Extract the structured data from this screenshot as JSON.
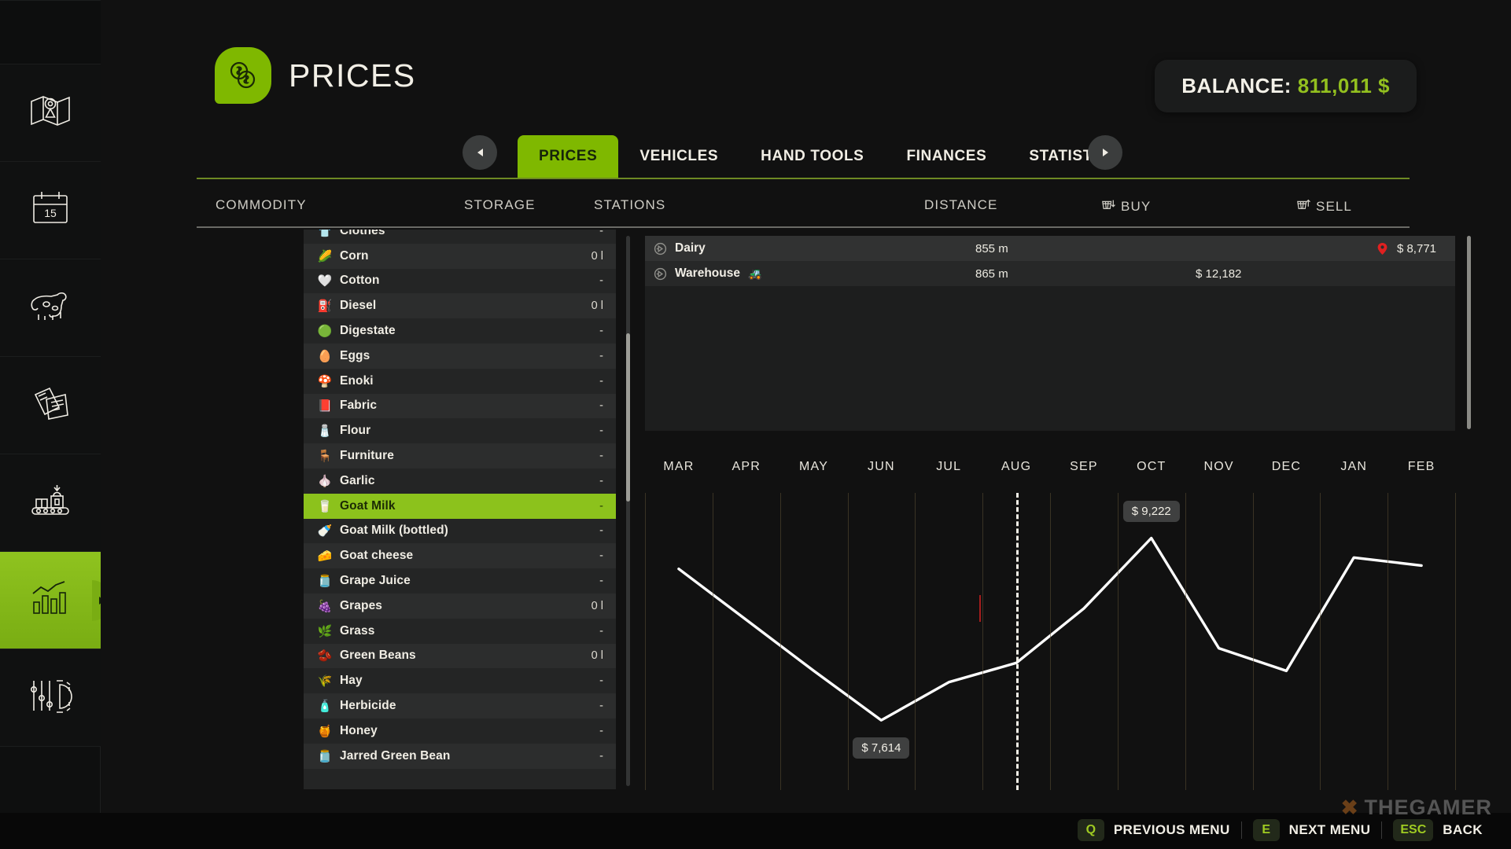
{
  "sidebar": {
    "items": [
      {
        "name": "map",
        "icon": "map-pin-icon",
        "active": false
      },
      {
        "name": "calendar",
        "icon": "calendar-15-icon",
        "active": false
      },
      {
        "name": "animals",
        "icon": "cow-icon",
        "active": false
      },
      {
        "name": "contracts",
        "icon": "documents-icon",
        "active": false
      },
      {
        "name": "production",
        "icon": "conveyor-icon",
        "active": false
      },
      {
        "name": "statistics",
        "icon": "bar-chart-icon",
        "active": true
      },
      {
        "name": "settings",
        "icon": "sliders-gear-icon",
        "active": false
      }
    ]
  },
  "header": {
    "title": "PRICES",
    "icon": "coins-dollar-icon",
    "balance_label": "BALANCE:",
    "balance_value": "811,011 $",
    "accent_color": "#7fb800",
    "balance_color": "#93c01f"
  },
  "tabs": {
    "prev_arrow": "chevron-left-icon",
    "next_arrow": "chevron-right-icon",
    "items": [
      {
        "label": "PRICES",
        "active": true
      },
      {
        "label": "VEHICLES",
        "active": false
      },
      {
        "label": "HAND TOOLS",
        "active": false
      },
      {
        "label": "FINANCES",
        "active": false
      },
      {
        "label": "STATISTICS",
        "active": false
      }
    ]
  },
  "columns": {
    "commodity": "COMMODITY",
    "storage": "STORAGE",
    "stations": "STATIONS",
    "distance": "DISTANCE",
    "buy": "BUY",
    "sell": "SELL",
    "buy_icon": "basket-down-icon",
    "sell_icon": "basket-up-icon"
  },
  "commodities": [
    {
      "name": "Clothes",
      "storage": "-",
      "emoji": "👕",
      "selected": false,
      "partial": true
    },
    {
      "name": "Corn",
      "storage": "0 l",
      "emoji": "🌽",
      "selected": false
    },
    {
      "name": "Cotton",
      "storage": "-",
      "emoji": "🤍",
      "selected": false
    },
    {
      "name": "Diesel",
      "storage": "0 l",
      "emoji": "⛽",
      "selected": false
    },
    {
      "name": "Digestate",
      "storage": "-",
      "emoji": "🟢",
      "selected": false
    },
    {
      "name": "Eggs",
      "storage": "-",
      "emoji": "🥚",
      "selected": false
    },
    {
      "name": "Enoki",
      "storage": "-",
      "emoji": "🍄",
      "selected": false
    },
    {
      "name": "Fabric",
      "storage": "-",
      "emoji": "📕",
      "selected": false
    },
    {
      "name": "Flour",
      "storage": "-",
      "emoji": "🧂",
      "selected": false
    },
    {
      "name": "Furniture",
      "storage": "-",
      "emoji": "🪑",
      "selected": false
    },
    {
      "name": "Garlic",
      "storage": "-",
      "emoji": "🧄",
      "selected": false
    },
    {
      "name": "Goat Milk",
      "storage": "-",
      "emoji": "🥛",
      "selected": true
    },
    {
      "name": "Goat Milk (bottled)",
      "storage": "-",
      "emoji": "🍼",
      "selected": false
    },
    {
      "name": "Goat cheese",
      "storage": "-",
      "emoji": "🧀",
      "selected": false
    },
    {
      "name": "Grape Juice",
      "storage": "-",
      "emoji": "🫙",
      "selected": false
    },
    {
      "name": "Grapes",
      "storage": "0 l",
      "emoji": "🍇",
      "selected": false
    },
    {
      "name": "Grass",
      "storage": "-",
      "emoji": "🌿",
      "selected": false
    },
    {
      "name": "Green Beans",
      "storage": "0 l",
      "emoji": "🫘",
      "selected": false
    },
    {
      "name": "Hay",
      "storage": "-",
      "emoji": "🌾",
      "selected": false
    },
    {
      "name": "Herbicide",
      "storage": "-",
      "emoji": "🧴",
      "selected": false
    },
    {
      "name": "Honey",
      "storage": "-",
      "emoji": "🍯",
      "selected": false
    },
    {
      "name": "Jarred Green Bean",
      "storage": "-",
      "emoji": "🫙",
      "selected": false
    }
  ],
  "stations": [
    {
      "name": "Dairy",
      "distance": "855 m",
      "buy": "",
      "sell": "$ 8,771",
      "marked": true,
      "has_vehicle_icon": false
    },
    {
      "name": "Warehouse",
      "distance": "865 m",
      "buy": "$ 12,182",
      "sell": "",
      "marked": false,
      "has_vehicle_icon": true
    }
  ],
  "chart_data": {
    "type": "line",
    "title": "",
    "xlabel": "",
    "ylabel": "",
    "categories": [
      "MAR",
      "APR",
      "MAY",
      "JUN",
      "JUL",
      "AUG",
      "SEP",
      "OCT",
      "NOV",
      "DEC",
      "JAN",
      "FEB"
    ],
    "series": [
      {
        "name": "Goat Milk price",
        "values": [
          8950,
          8500,
          8050,
          7614,
          7950,
          8120,
          8600,
          9222,
          8250,
          8050,
          9050,
          8980
        ]
      }
    ],
    "ylim": [
      7400,
      9400
    ],
    "grid": true,
    "legend": "none",
    "annotations": [
      {
        "label": "$ 7,614",
        "at_category": "JUN",
        "kind": "min-label"
      },
      {
        "label": "$ 9,222",
        "at_category": "OCT",
        "kind": "max-label"
      }
    ],
    "current_month_marker": {
      "at_category": "AUG",
      "style": "dashed-vertical-white"
    }
  },
  "footer": {
    "keys": [
      {
        "key": "Q",
        "label": "PREVIOUS MENU"
      },
      {
        "key": "E",
        "label": "NEXT MENU"
      },
      {
        "key": "ESC",
        "label": "BACK"
      }
    ],
    "watermark": "THEGAMER"
  }
}
